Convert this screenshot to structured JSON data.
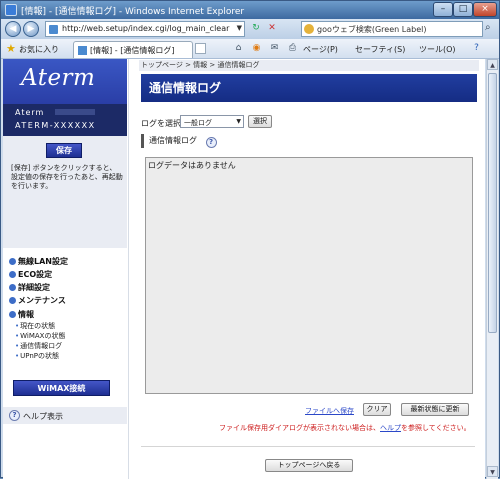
{
  "window": {
    "title": "[情報] - [通信情報ログ] - Windows Internet Explorer"
  },
  "address": {
    "url": "http://web.setup/index.cgi/log_main_clear"
  },
  "search": {
    "placeholder": "gooウェブ検索(Green Label)"
  },
  "favorites": {
    "label": "お気に入り",
    "tab_label": "[情報] - [通信情報ログ]"
  },
  "command_bar": {
    "page": "ページ(P)",
    "safety": "セーフティ(S)",
    "tools": "ツール(O)"
  },
  "sidebar": {
    "brand": "Aterm",
    "model_line1": "Aterm",
    "model_line2": "ATERM-XXXXXX",
    "save_label": "保存",
    "save_note": "[保存] ボタンをクリックすると、設定値の保存を行ったあと、再起動を行います。",
    "nav": [
      {
        "label": "無線LAN設定"
      },
      {
        "label": "ECO設定"
      },
      {
        "label": "詳細設定"
      },
      {
        "label": "メンテナンス"
      },
      {
        "label": "情報"
      }
    ],
    "sub": [
      {
        "label": "現在の状態"
      },
      {
        "label": "WiMAXの状態"
      },
      {
        "label": "通信情報ログ"
      },
      {
        "label": "UPnPの状態"
      }
    ],
    "wimax_label": "WiMAX接続",
    "help_label": "ヘルプ表示"
  },
  "main": {
    "breadcrumb": "トップページ > 情報 > 通信情報ログ",
    "title": "通信情報ログ",
    "select_label": "ログを選択",
    "select_value": "一般ログ",
    "select_button": "選択",
    "section_title": "通信情報ログ",
    "log_text": "ログデータはありません",
    "file_link": "ファイルへ保存",
    "clear_button": "クリア",
    "refresh_button": "最新状態に更新",
    "warn_prefix": "ファイル保存用ダイアログが表示されない場合は、",
    "warn_link": "ヘルプ",
    "warn_suffix": "を参照してください。",
    "top_button": "トップページへ戻る"
  },
  "colors": {
    "brand_blue": "#2a3ea6",
    "warn_red": "#cc1a1a",
    "link_blue": "#2b48c8"
  }
}
